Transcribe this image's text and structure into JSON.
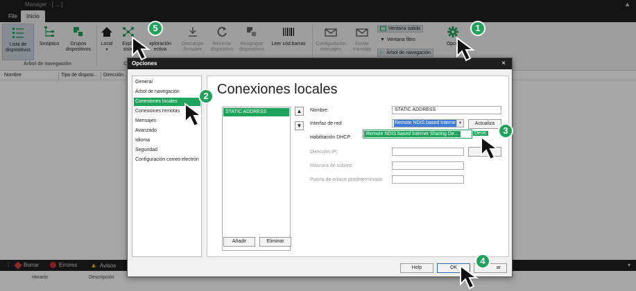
{
  "window": {
    "title": "Manager · [ ... ]",
    "collapse_glyph": "▲"
  },
  "tabs": [
    {
      "label": "File"
    },
    {
      "label": "Inicio"
    }
  ],
  "ribbon": {
    "device_list": "Lista de\ndispositivos",
    "synoptic": "Sinóptico",
    "groups": "Grupos\ndispositivos",
    "local": "Local",
    "explore": "Explo",
    "explore_line2": "siste",
    "exploration": "xploración",
    "exploration_line2": "ectiva",
    "download_fw": "Descargar\nfirmware",
    "restart": "Reiniciar\ndispositivo",
    "regroup": "Reagrupar\ndispositivos",
    "barcode": "Leer cód.barras",
    "config_msgs": "Configuración\nmensajes",
    "send_msg": "Enviar\nmensaje",
    "output_window": "Ventana salida",
    "filter_window": "Ventana filtro",
    "nav_tree": "Árbol de navegación",
    "options": "Opcio",
    "group_nav": "Árbol de navegación",
    "group_c": "Co"
  },
  "device_list": {
    "columns": [
      "Nombre",
      "Tipo de disposi...",
      "Dirección ..."
    ]
  },
  "log_bar": {
    "clear": "Borrar",
    "errors": "Errores",
    "warnings": "Avisos",
    "columns": [
      "Horario",
      "Descripción"
    ]
  },
  "dialog": {
    "title": "Opciones",
    "close_glyph": "×",
    "nav_items": [
      {
        "label": "General",
        "selected": false
      },
      {
        "label": "Árbol de navegación",
        "selected": false
      },
      {
        "label": "Conexiones locales",
        "selected": true
      },
      {
        "label": "Conexiones remotas",
        "selected": false
      },
      {
        "label": "Mensajes",
        "selected": false
      },
      {
        "label": "Avanzado",
        "selected": false
      },
      {
        "label": "Idioma",
        "selected": false
      },
      {
        "label": "Seguridad",
        "selected": false
      },
      {
        "label": "Configuración correo electrón",
        "selected": false
      }
    ],
    "heading": "Conexiones locales",
    "addresses": [
      "STATIC ADDRESS"
    ],
    "add_button": "Añadir",
    "remove_button": "Eliminar",
    "fields": {
      "name_label": "Nombre:",
      "name_value": "STATIC ADDRESS",
      "iface_label": "Interfaz de red:",
      "iface_value": "Remote NDIS based Interne",
      "update_button": "Actualiza",
      "devices_fragment": "Devic",
      "dropdown_option": "Remote NDIS based Internet Sharing De...",
      "dhcp_label": "Habilitación DHCP:",
      "ip_label": "Dirección IP:",
      "ip_button_fragment": "A",
      "mask_label": "Máscara de subred:",
      "gateway_label": "Puerta de enlace predeterminada:"
    },
    "help_button": "Help",
    "ok_button": "OK",
    "cancel_fragment": "ar"
  },
  "steps": [
    "1",
    "2",
    "3",
    "4",
    "5"
  ],
  "colors": {
    "accent": "#1ea35b",
    "dark_bar": "#1f1f1f",
    "selection_blue": "#3d7bd6"
  }
}
